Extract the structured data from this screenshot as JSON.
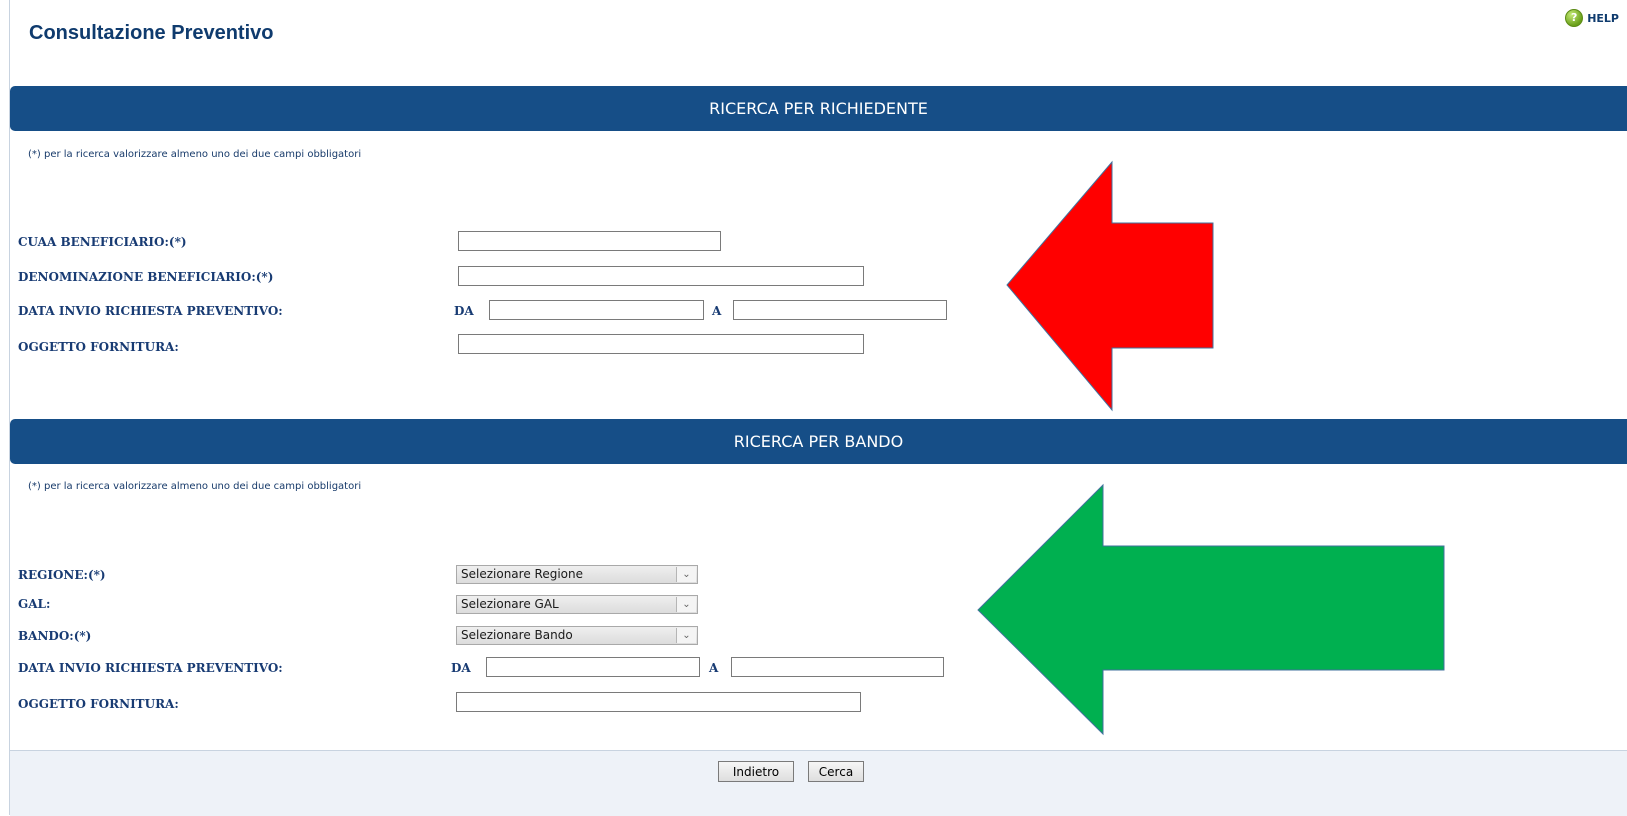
{
  "page": {
    "title": "Consultazione Preventivo",
    "help_label": "HELP"
  },
  "richiedente": {
    "header": "RICERCA PER RICHIEDENTE",
    "note": "(*) per la ricerca valorizzare almeno uno dei due campi obbligatori",
    "cuaa_label": "CUAA BENEFICIARIO:(*)",
    "denominazione_label": "DENOMINAZIONE BENEFICIARIO:(*)",
    "data_invio_label": "DATA INVIO RICHIESTA PREVENTIVO:",
    "da_label": "DA",
    "a_label": "A",
    "oggetto_label": "OGGETTO FORNITURA:",
    "cuaa_value": "",
    "denominazione_value": "",
    "data_da_value": "",
    "data_a_value": "",
    "oggetto_value": ""
  },
  "bando": {
    "header": "RICERCA PER BANDO",
    "note": "(*) per la ricerca valorizzare almeno uno dei due campi obbligatori",
    "regione_label": "REGIONE:(*)",
    "regione_value": "Selezionare Regione",
    "gal_label": "GAL:",
    "gal_value": "Selezionare GAL",
    "bando_label": "BANDO:(*)",
    "bando_value": "Selezionare Bando",
    "data_invio_label": "DATA INVIO RICHIESTA PREVENTIVO:",
    "da_label": "DA",
    "a_label": "A",
    "oggetto_label": "OGGETTO FORNITURA:",
    "data_da_value": "",
    "data_a_value": "",
    "oggetto_value": ""
  },
  "buttons": {
    "back_label": "Indietro",
    "search_label": "Cerca"
  },
  "icons": {
    "help": "help-icon",
    "select_arrow": "chevron-down-icon"
  },
  "colors": {
    "band": "#164e87",
    "annotation_top_arrow": "#ff0000",
    "annotation_bottom_arrow": "#00b050",
    "arrow_outline": "#41719c"
  }
}
